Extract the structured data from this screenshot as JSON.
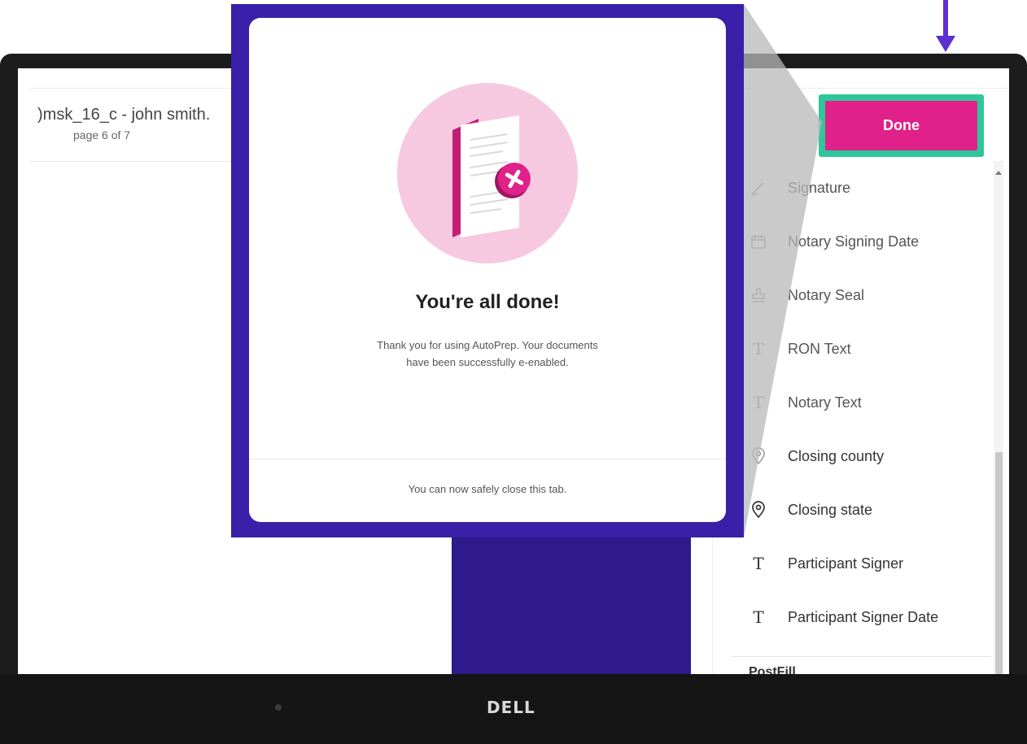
{
  "document": {
    "title": ")msk_16_c - john smith.",
    "page_indicator": "page 6 of 7"
  },
  "toolbar": {
    "done_label": "Done"
  },
  "side_panel": {
    "fields": [
      {
        "label": "Signature",
        "icon": "pen-icon"
      },
      {
        "label": "Notary Signing Date",
        "icon": "calendar-icon"
      },
      {
        "label": "Notary Seal",
        "icon": "stamp-icon"
      },
      {
        "label": "RON Text",
        "icon": "text-icon"
      },
      {
        "label": "Notary Text",
        "icon": "text-icon"
      },
      {
        "label": "Closing county",
        "icon": "location-pin-icon"
      },
      {
        "label": "Closing state",
        "icon": "location-pin-icon"
      },
      {
        "label": "Participant Signer",
        "icon": "text-icon"
      },
      {
        "label": "Participant Signer Date",
        "icon": "text-icon"
      }
    ],
    "section_label": "PostFill"
  },
  "modal": {
    "title": "You're all done!",
    "message_line1": "Thank you for using AutoPrep. Your documents",
    "message_line2": "have been successfully e-enabled.",
    "footer": "You can now safely close this tab."
  },
  "device": {
    "brand": "DELL"
  },
  "colors": {
    "accent_pink": "#e0218a",
    "highlight_green": "#2fc79a",
    "callout_purple": "#3a1fa8",
    "arrow_purple": "#5b2fd0"
  }
}
